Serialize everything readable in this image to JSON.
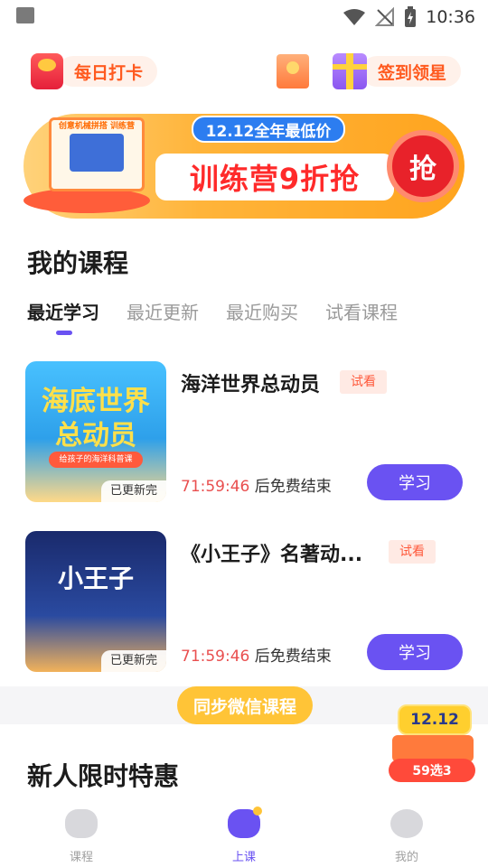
{
  "status_bar": {
    "time": "10:36"
  },
  "header": {
    "checkin_label": "每日打卡",
    "stars_label": "签到领星"
  },
  "banner": {
    "kit_title": "创意机械拼搭 训练营",
    "tag": "12.12全年最低价",
    "headline": "训练营9折抢",
    "grab_label": "抢"
  },
  "my_courses": {
    "title": "我的课程",
    "tabs": [
      "最近学习",
      "最近更新",
      "最近购买",
      "试看课程"
    ],
    "active_tab": 0,
    "items": [
      {
        "thumb_title": "海底世界 总动员",
        "thumb_sub": "给孩子的海洋科普课",
        "badge": "已更新完",
        "name": "海洋世界总动员",
        "tag": "试看",
        "countdown": "71:59:46",
        "countdown_suffix": "后免费结束",
        "button": "学习"
      },
      {
        "thumb_title": "小王子",
        "thumb_sub": "",
        "badge": "已更新完",
        "name": "《小王子》名著动...",
        "tag": "试看",
        "countdown": "71:59:46",
        "countdown_suffix": "后免费结束",
        "button": "学习"
      }
    ]
  },
  "sync_button": "同步微信课程",
  "promo_float": {
    "top": "12.12",
    "bottom": "59选3"
  },
  "new_user": {
    "title": "新人限时特惠"
  },
  "bottom_nav": {
    "items": [
      "课程",
      "上课",
      "我的"
    ],
    "active": 1
  },
  "colors": {
    "accent": "#6a52f2",
    "orange": "#ff5a1f",
    "countdown": "#e94f4f",
    "sync": "#ffc437"
  }
}
